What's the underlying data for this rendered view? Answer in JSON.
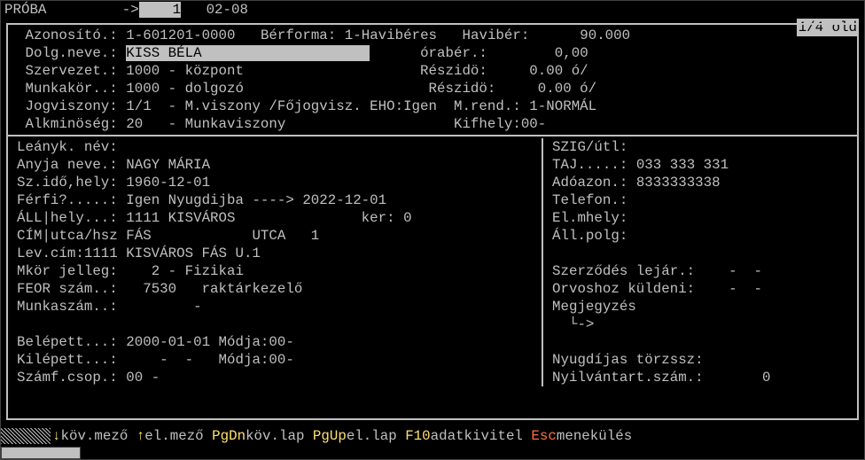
{
  "topbar": {
    "title": "PRÓBA",
    "arrow": "->",
    "field_value": "    1",
    "date": "02-08"
  },
  "page_indicator": "1/4 old",
  "block1": {
    "l1a": "Azonosító.:",
    "l1v": "1-601201-0000",
    "l1b": "Bérforma:",
    "l1bv": "1-Havibéres",
    "l1c": "Havibér:",
    "l1cv": "90.000",
    "l2a": "Dolg.neve.:",
    "l2v": "KISS BÉLA                    ",
    "l2c": "órabér.:",
    "l2cv": "0,00",
    "l3a": "Szervezet.:",
    "l3v": "1000 - központ",
    "l3c": "Részidö:",
    "l3cv": "0.00 ó/",
    "l4a": "Munkakör..:",
    "l4v": "1000 - dolgozó",
    "l4c": "Részidö:",
    "l4cv": "0.00 ó/",
    "l5a": "Jogviszony:",
    "l5v": "1/1  - M.viszony /Főjogvisz. EHO:Igen",
    "l5c": "M.rend.:",
    "l5cv": "1-NORMÁL",
    "l6a": "Alkminöség:",
    "l6v": "20   - Munkaviszony",
    "l6c": "Kifhely:",
    "l6cv": "00-"
  },
  "left": {
    "r1": "Leányk. név:",
    "r2a": "Anyja neve.:",
    "r2v": "NAGY MÁRIA",
    "r3a": "Sz.idő,hely:",
    "r3v": "1960-12-01",
    "r4a": "Férfi?.....:",
    "r4v": "Igen Nyugdijba ----> 2022-12-01",
    "r5a": "ÁLL|hely...:",
    "r5v": "1111 KISVÁROS               ker: 0",
    "r6a": "CÍM|utca/hsz",
    "r6v": "FÁS            UTCA   1",
    "r7": "Lev.cím:1111 KISVÁROS FÁS U.1",
    "r8a": "Mkör jelleg:",
    "r8v": "   2 - Fizikai",
    "r9a": "FEOR szám..:",
    "r9v": "  7530   raktárkezelő",
    "r10a": "Munkaszám..:",
    "r10v": "        -",
    "r11": "",
    "r12a": "Belépett...:",
    "r12v": "2000-01-01 Módja:00-",
    "r13a": "Kilépett...:",
    "r13v": "    -  -   Módja:00-",
    "r14a": "Számf.csop.:",
    "r14v": "00 -"
  },
  "right": {
    "r1": "SZIG/útl:",
    "r2a": "TAJ.....:",
    "r2v": "033 333 331",
    "r3a": "Adóazon.:",
    "r3v": "8333333338",
    "r4": "Telefon.:",
    "r5": "El.mhely:",
    "r6": "Áll.polg:",
    "r7": "",
    "r8a": "Szerződés lejár.:",
    "r8v": "   -  -",
    "r9a": "Orvoshoz küldeni:",
    "r9v": "   -  -",
    "r10": "Megjegyzés",
    "r11": "  └->",
    "r12": "",
    "r13": "Nyugdíjas törzssz:",
    "r14a": "Nyilvántart.szám.:",
    "r14v": "       0"
  },
  "status": {
    "kdown": "↓",
    "t1": "köv.mező ",
    "kup": "↑",
    "t2": "el.mező ",
    "kpgdn": "PgDn",
    "t3": "köv.lap ",
    "kpgup": "PgUp",
    "t4": "el.lap ",
    "kf10": "F10",
    "t5": "adatkivitel ",
    "kesc": "Esc",
    "t6": "menekülés"
  }
}
